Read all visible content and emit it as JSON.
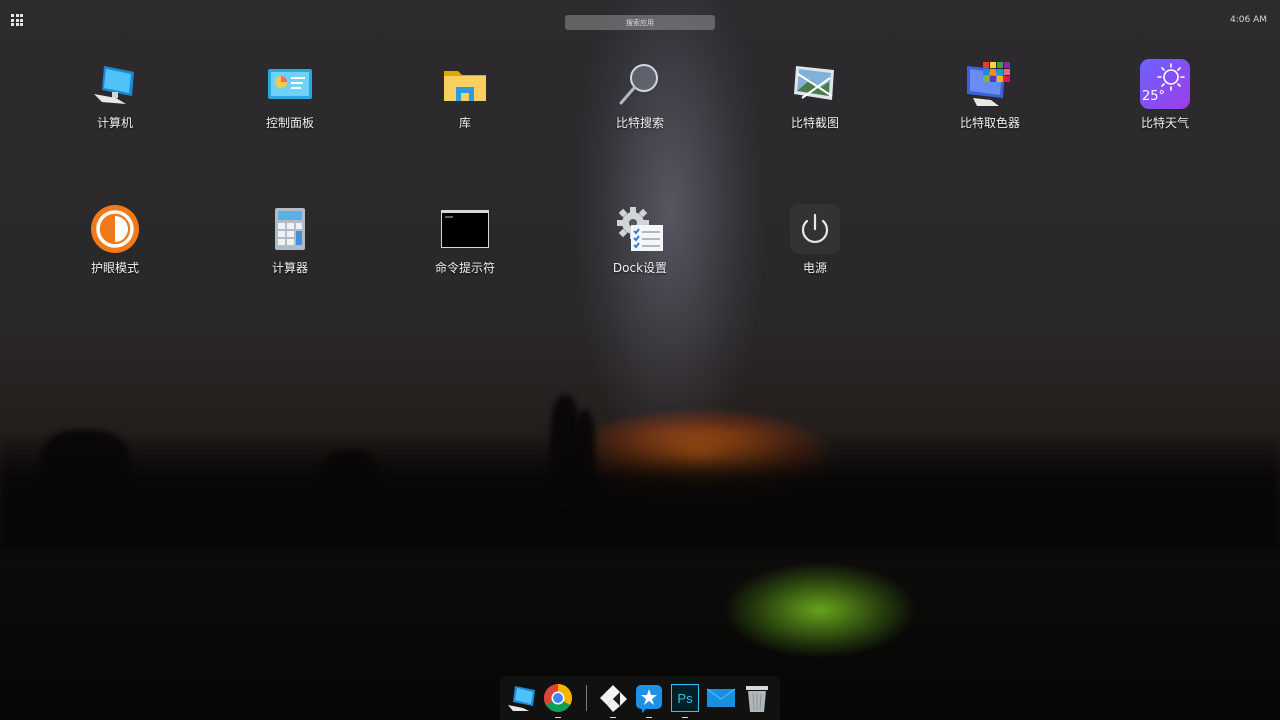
{
  "topbar": {
    "search_placeholder": "搜索应用",
    "clock": "4:06 AM"
  },
  "apps": [
    {
      "label": "计算机",
      "icon": "computer-icon"
    },
    {
      "label": "控制面板",
      "icon": "control-panel-icon"
    },
    {
      "label": "库",
      "icon": "folder-icon"
    },
    {
      "label": "比特搜索",
      "icon": "search-magnifier-icon"
    },
    {
      "label": "比特截图",
      "icon": "screenshot-icon"
    },
    {
      "label": "比特取色器",
      "icon": "color-picker-icon"
    },
    {
      "label": "比特天气",
      "icon": "weather-icon",
      "temp": "25°"
    },
    {
      "label": "护眼模式",
      "icon": "eye-protection-icon"
    },
    {
      "label": "计算器",
      "icon": "calculator-icon"
    },
    {
      "label": "命令提示符",
      "icon": "terminal-icon"
    },
    {
      "label": "Dock设置",
      "icon": "dock-settings-icon"
    },
    {
      "label": "电源",
      "icon": "power-icon"
    }
  ],
  "dock": {
    "items": [
      {
        "name": "computer",
        "icon": "computer-icon",
        "running": false
      },
      {
        "name": "chrome",
        "icon": "chrome-icon",
        "running": true
      },
      {
        "name": "kodi",
        "icon": "kodi-icon",
        "running": true
      },
      {
        "name": "bookmark-app",
        "icon": "star-app-icon",
        "running": true
      },
      {
        "name": "photoshop",
        "icon": "photoshop-icon",
        "running": true,
        "text": "Ps"
      },
      {
        "name": "mail",
        "icon": "mail-icon",
        "running": false
      },
      {
        "name": "trash",
        "icon": "trash-icon",
        "running": false
      }
    ]
  },
  "colors": {
    "eye_orange": "#f07a1a",
    "weather_purple": "#7a4de8",
    "accent_blue": "#2d9be3"
  }
}
